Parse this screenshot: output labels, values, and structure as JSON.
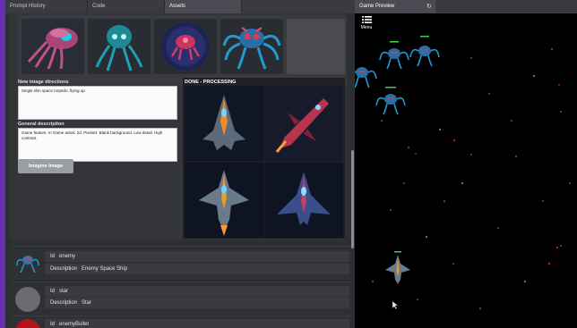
{
  "tabs": [
    {
      "label": "Prompt History"
    },
    {
      "label": "Code"
    },
    {
      "label": "Assets"
    }
  ],
  "form": {
    "directions_label": "New image directions",
    "directions_value": "Single slim space torpedo, flying up",
    "description_label": "General description",
    "description_value": "Game feature. In Game asset. 2d. Pixelart. Blank background. Low detail. High contrast.",
    "imagine_button": "Imagine Image"
  },
  "processing": {
    "title": "DONE - PROCESSING"
  },
  "assets": [
    {
      "id_label": "Id",
      "id": "enemy",
      "desc_label": "Description",
      "description": "Enemy Space Ship"
    },
    {
      "id_label": "Id",
      "id": "star",
      "desc_label": "Description",
      "description": "Star"
    },
    {
      "id_label": "Id",
      "id": "enemyBullet"
    }
  ],
  "preview": {
    "title": "Game Preview",
    "refresh_icon": "↻",
    "menu_label": "Menu"
  },
  "colors": {
    "accent": "#6a2fb0",
    "panel": "#2e2f33",
    "tab_active": "#4a4b52"
  }
}
